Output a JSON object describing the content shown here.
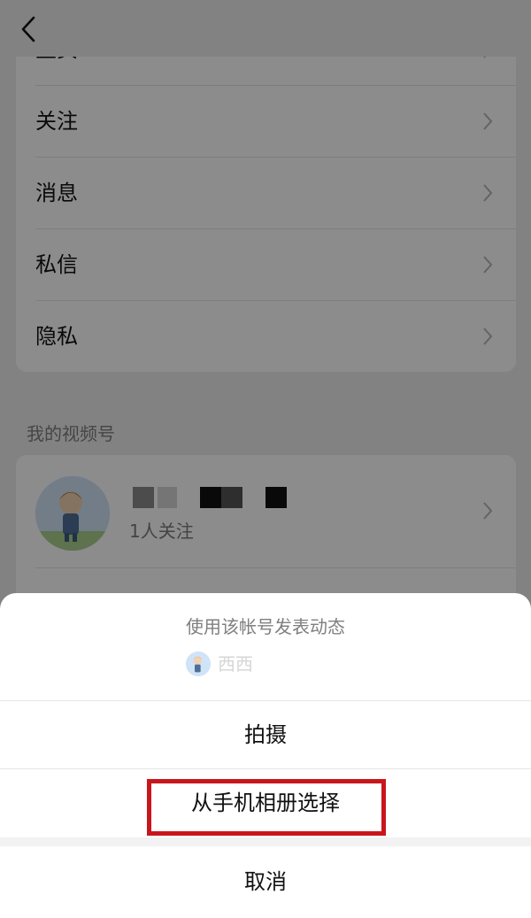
{
  "header": {
    "back_icon": "chevron-left-icon"
  },
  "settings_list": {
    "items": [
      {
        "label": "主页"
      },
      {
        "label": "关注"
      },
      {
        "label": "消息"
      },
      {
        "label": "私信"
      },
      {
        "label": "隐私"
      }
    ]
  },
  "channels": {
    "section_title": "我的视频号",
    "account": {
      "followers": "1人关注"
    }
  },
  "action_sheet": {
    "title": "使用该帐号发表动态",
    "account_name": "西西",
    "options": [
      {
        "label": "拍摄"
      },
      {
        "label": "从手机相册选择"
      }
    ],
    "cancel_label": "取消",
    "highlight_color": "#c8161d"
  }
}
